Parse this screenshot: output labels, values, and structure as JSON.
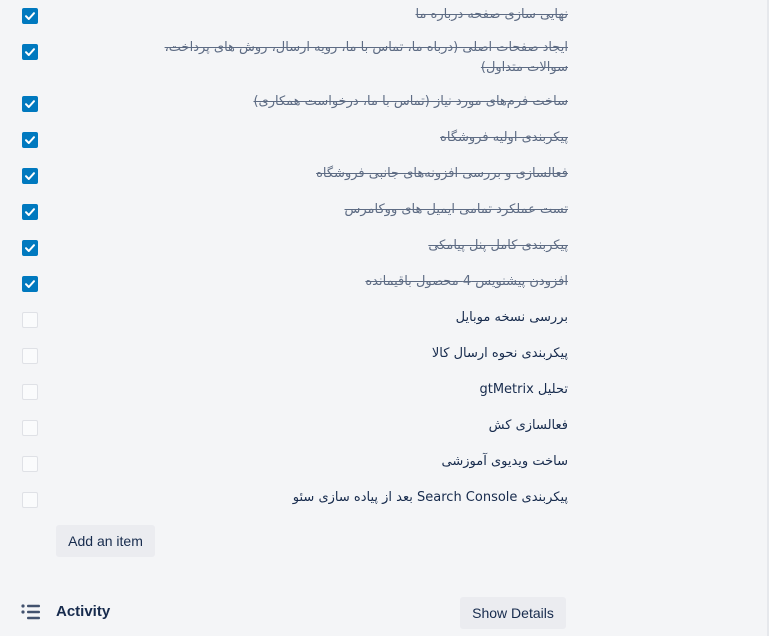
{
  "checklist": {
    "items": [
      {
        "text": "نهایی سازی صفحه درباره ما",
        "checked": true
      },
      {
        "text": "ایجاد صفحات اصلی (درباه ما، تماس با ما، رویه ارسال، روش های پرداخت، سوالات متداول)",
        "checked": true
      },
      {
        "text": "ساخت فرم‌های مورد نیاز (تماس با ما، درخواست همکاری)",
        "checked": true
      },
      {
        "text": "پیکربندی اولیه فروشگاه",
        "checked": true
      },
      {
        "text": "فعالسازی و بررسی افزونه‌های جانبی فروشگاه",
        "checked": true
      },
      {
        "text": "تست عملکرد تمامی ایمیل های ووکامرس",
        "checked": true
      },
      {
        "text": "پیکربندی کامل پنل پیامکی",
        "checked": true
      },
      {
        "text": "افزودن پیشنویس 4 محصول باقیمانده",
        "checked": true
      },
      {
        "text": "بررسی نسخه موبایل",
        "checked": false
      },
      {
        "text": "پیکربندی نحوه ارسال کالا",
        "checked": false
      },
      {
        "text": "تحلیل gtMetrix",
        "checked": false
      },
      {
        "text": "فعالسازی کش",
        "checked": false
      },
      {
        "text": "ساخت ویدیوی آموزشی",
        "checked": false
      },
      {
        "text": "پیکربندی Search Console بعد از پیاده سازی سئو",
        "checked": false
      }
    ],
    "add_item_label": "Add an item"
  },
  "activity": {
    "icon": "activity-list-icon",
    "title": "Activity",
    "show_details_label": "Show Details"
  },
  "colors": {
    "accent": "#0079bf",
    "background": "#f4f5f7",
    "button_bg": "#ebecf0"
  }
}
